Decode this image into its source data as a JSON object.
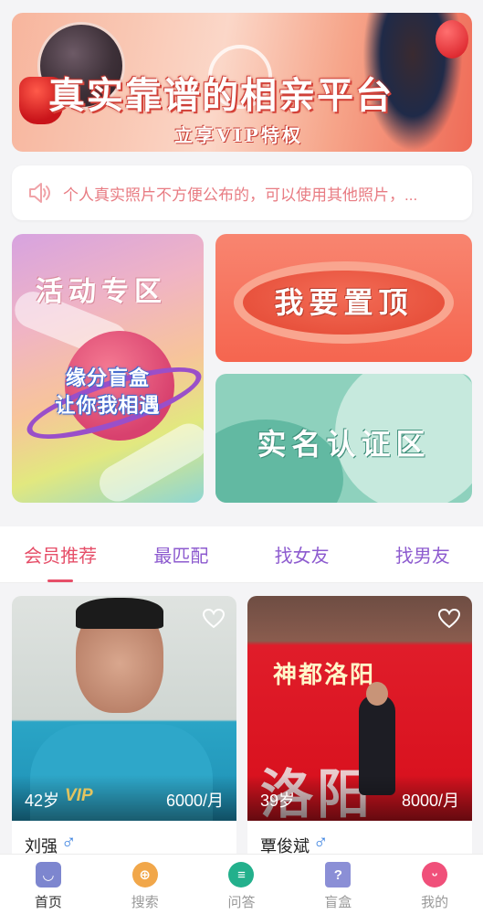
{
  "banner": {
    "title": "真实靠谱的相亲平台",
    "subtitle": "立享VIP特权"
  },
  "notice": {
    "icon": "speaker-icon",
    "text": "个人真实照片不方便公布的，可以使用其他照片，..."
  },
  "tiles": {
    "activity": {
      "heading": "活动专区",
      "line1": "缘分盲盒",
      "line2": "让你我相遇"
    },
    "top": {
      "heading": "我要置顶"
    },
    "verify": {
      "heading": "实名认证区"
    }
  },
  "tabs": [
    {
      "label": "会员推荐",
      "active": true
    },
    {
      "label": "最匹配",
      "active": false
    },
    {
      "label": "找女友",
      "active": false
    },
    {
      "label": "找男友",
      "active": false
    }
  ],
  "cards": [
    {
      "age": "42岁",
      "vip": "VIP",
      "salary": "6000/月",
      "name": "刘强",
      "gender_symbol": "♂"
    },
    {
      "age": "39岁",
      "salary": "8000/月",
      "name": "覃俊斌",
      "gender_symbol": "♂",
      "photo_text_top": "神都洛阳",
      "photo_text_big": "洛阳"
    }
  ],
  "nav": [
    {
      "label": "首页",
      "icon": "home-icon",
      "active": true
    },
    {
      "label": "搜索",
      "icon": "search-icon",
      "active": false
    },
    {
      "label": "问答",
      "icon": "chat-icon",
      "active": false
    },
    {
      "label": "盲盒",
      "icon": "mystery-box-icon",
      "active": false
    },
    {
      "label": "我的",
      "icon": "profile-icon",
      "active": false
    }
  ],
  "colors": {
    "accent": "#e64f69",
    "tab_text": "#8d5bcf",
    "notice_text": "#e87c83",
    "gender_male": "#3b82e0"
  }
}
